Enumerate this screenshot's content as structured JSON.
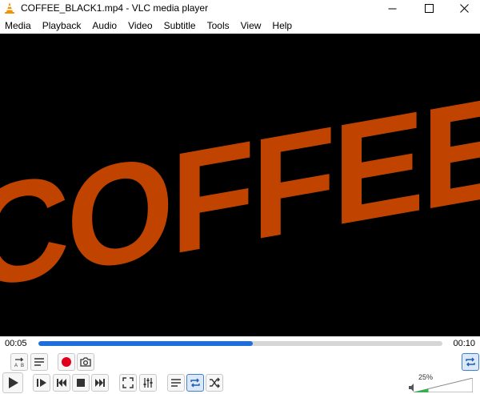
{
  "window": {
    "title": "COFFEE_BLACK1.mp4 - VLC media player",
    "controls": [
      "minimize",
      "maximize",
      "close"
    ]
  },
  "menu": {
    "items": [
      "Media",
      "Playback",
      "Audio",
      "Video",
      "Subtitle",
      "Tools",
      "View",
      "Help"
    ]
  },
  "video": {
    "text": "COFFEE",
    "text_color": "#c04400",
    "background": "#000000"
  },
  "seek": {
    "elapsed": "00:05",
    "total": "00:10",
    "progress_percent": 53,
    "fill_color": "#1e6fd9"
  },
  "volume": {
    "percent_label": "25%",
    "level_percent": 25,
    "fill_color": "#2db34a"
  },
  "icons": {
    "top_row": [
      "ab-loop-icon",
      "playlist-frame-icon",
      "record-icon",
      "snapshot-icon",
      "loop-toggle-icon"
    ],
    "bottom_row": [
      "play-icon",
      "frame-step-icon",
      "previous-icon",
      "stop-icon",
      "next-icon",
      "fullscreen-icon",
      "extended-settings-icon",
      "playlist-icon",
      "loop-icon",
      "shuffle-icon",
      "speaker-icon"
    ]
  },
  "colors": {
    "record": "#e0001b",
    "accent": "#1e6fd9",
    "vlc_orange": "#f29400"
  }
}
